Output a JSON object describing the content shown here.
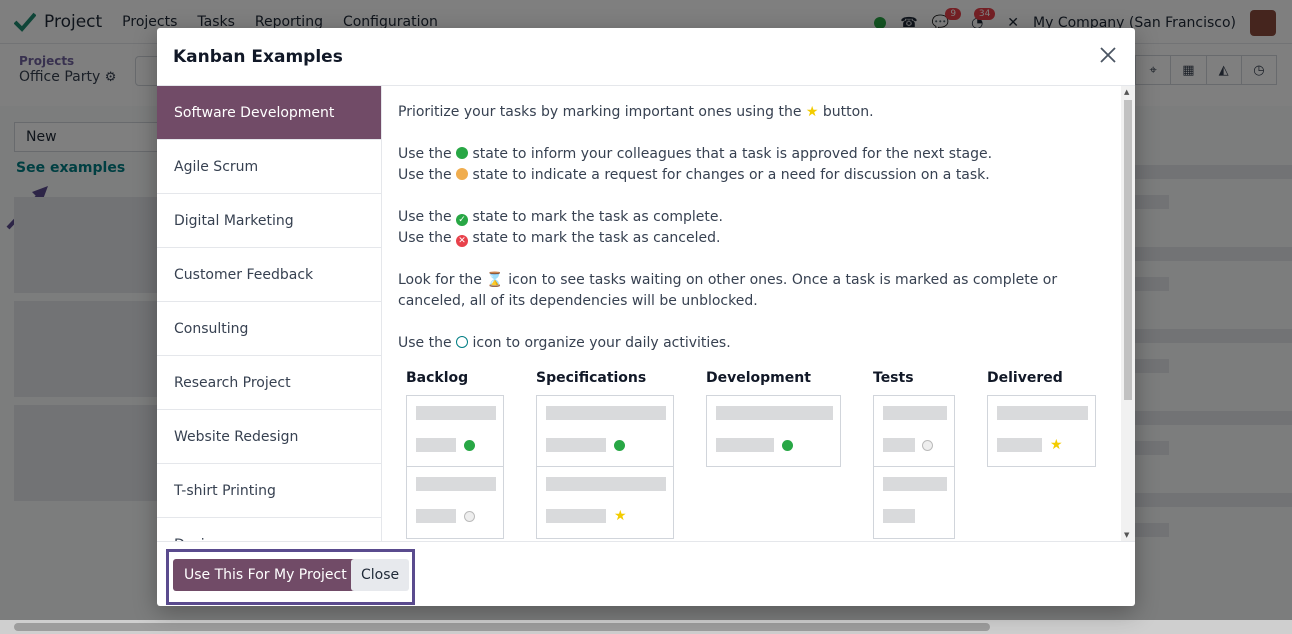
{
  "app": {
    "name": "Project",
    "menu": [
      "Projects",
      "Tasks",
      "Reporting",
      "Configuration"
    ],
    "company": "My Company (San Francisco)",
    "chat_count": "9",
    "activity_count": "34"
  },
  "breadcrumb": {
    "parent": "Projects",
    "current": "Office Party"
  },
  "board": {
    "column_placeholder": "New",
    "see_examples": "See examples"
  },
  "modal": {
    "title": "Kanban Examples",
    "tabs": [
      {
        "label": "Software Development"
      },
      {
        "label": "Agile Scrum"
      },
      {
        "label": "Digital Marketing"
      },
      {
        "label": "Customer Feedback"
      },
      {
        "label": "Consulting"
      },
      {
        "label": "Research Project"
      },
      {
        "label": "Website Redesign"
      },
      {
        "label": "T-shirt Printing"
      },
      {
        "label": "Design"
      }
    ],
    "text": {
      "p1a": "Prioritize your tasks by marking important ones using the",
      "p1b": "button.",
      "p2a_pre": "Use the",
      "p2a_post": "state to inform your colleagues that a task is approved for the next stage.",
      "p2b_pre": "Use the",
      "p2b_post": "state to indicate a request for changes or a need for discussion on a task.",
      "p3a_pre": "Use the",
      "p3a_post": "state to mark the task as complete.",
      "p3b_pre": "Use the",
      "p3b_post": "state to mark the task as canceled.",
      "p4_pre": "Look for the",
      "p4_post": "icon to see tasks waiting on other ones. Once a task is marked as complete or canceled, all of its dependencies will be unblocked.",
      "p5_pre": "Use the",
      "p5_post": "icon to organize your daily activities."
    },
    "stages": [
      "Backlog",
      "Specifications",
      "Development",
      "Tests",
      "Delivered"
    ],
    "buttons": {
      "use": "Use This For My Project",
      "close": "Close"
    }
  },
  "colors": {
    "primary": "#714b67",
    "highlight": "#5a4b8e",
    "green": "#28a745",
    "orange": "#f0ad4e",
    "red": "#e8414b",
    "star": "#f3cc00"
  }
}
